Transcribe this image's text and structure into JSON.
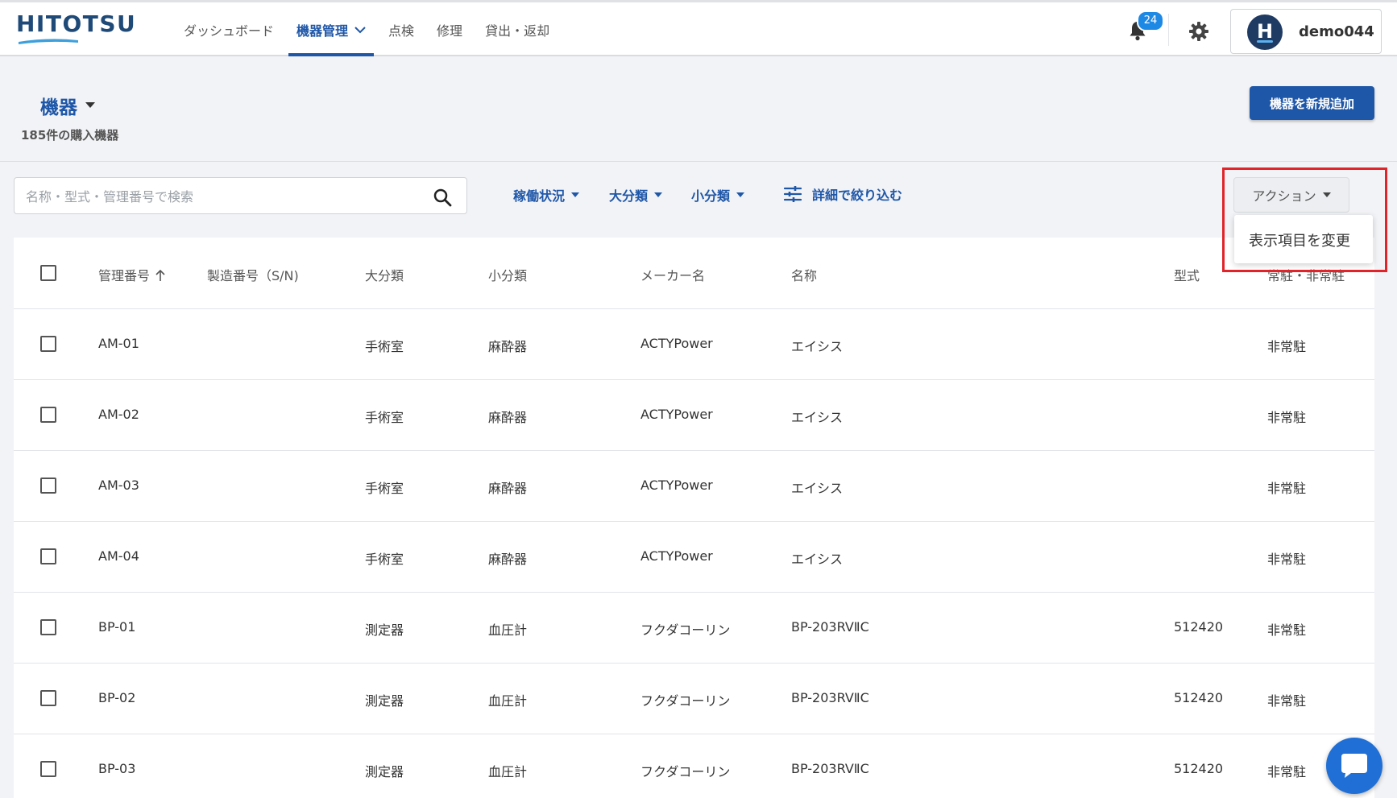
{
  "app": {
    "logo": "HITOTSU",
    "brand_color": "#1f57a8",
    "alert_color": "#e0242a"
  },
  "nav": [
    {
      "label": "ダッシュボード"
    },
    {
      "label": "機器管理",
      "active": true,
      "icon": "chevron-down-icon"
    },
    {
      "label": "点検"
    },
    {
      "label": "修理"
    },
    {
      "label": "貸出・返却"
    }
  ],
  "header": {
    "notifications": "24",
    "avatar_letter": "H",
    "username": "demo044"
  },
  "page": {
    "title": "機器",
    "subtitle": "185件の購入機器",
    "add_button": "機器を新規追加"
  },
  "filters": {
    "search_placeholder": "名称・型式・管理番号で検索",
    "status": "稼働状況",
    "major": "大分類",
    "minor": "小分類",
    "detail": "詳細で絞り込む",
    "action": "アクション",
    "action_menu_item": "表示項目を変更"
  },
  "table": {
    "columns": [
      "管理番号",
      "製造番号（S/N)",
      "大分類",
      "小分類",
      "メーカー名",
      "名称",
      "型式",
      "常駐・非常駐"
    ],
    "rows": [
      {
        "id": "AM-01",
        "sn": "",
        "major": "手術室",
        "minor": "麻酔器",
        "maker": "ACTYPower",
        "name": "エイシス",
        "model": "",
        "resident": "非常駐"
      },
      {
        "id": "AM-02",
        "sn": "",
        "major": "手術室",
        "minor": "麻酔器",
        "maker": "ACTYPower",
        "name": "エイシス",
        "model": "",
        "resident": "非常駐"
      },
      {
        "id": "AM-03",
        "sn": "",
        "major": "手術室",
        "minor": "麻酔器",
        "maker": "ACTYPower",
        "name": "エイシス",
        "model": "",
        "resident": "非常駐"
      },
      {
        "id": "AM-04",
        "sn": "",
        "major": "手術室",
        "minor": "麻酔器",
        "maker": "ACTYPower",
        "name": "エイシス",
        "model": "",
        "resident": "非常駐"
      },
      {
        "id": "BP-01",
        "sn": "",
        "major": "測定器",
        "minor": "血圧計",
        "maker": "フクダコーリン",
        "name": "BP-203RVⅡC",
        "model": "512420",
        "resident": "非常駐"
      },
      {
        "id": "BP-02",
        "sn": "",
        "major": "測定器",
        "minor": "血圧計",
        "maker": "フクダコーリン",
        "name": "BP-203RVⅡC",
        "model": "512420",
        "resident": "非常駐"
      },
      {
        "id": "BP-03",
        "sn": "",
        "major": "測定器",
        "minor": "血圧計",
        "maker": "フクダコーリン",
        "name": "BP-203RVⅡC",
        "model": "512420",
        "resident": "非常駐"
      }
    ]
  }
}
